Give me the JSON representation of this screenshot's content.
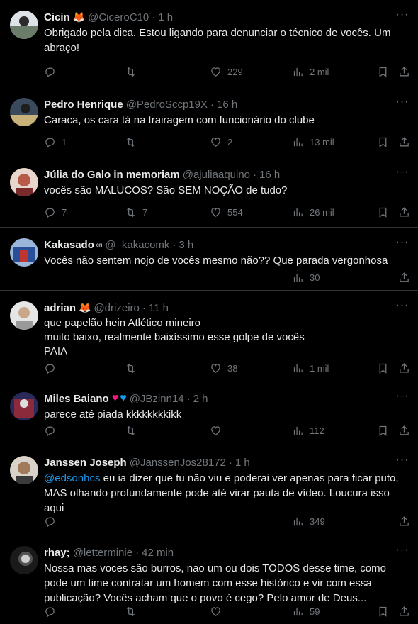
{
  "tweets": [
    {
      "name": "Cicin",
      "badge": "🦊",
      "handle": "@CiceroC10",
      "dot": "·",
      "time": "1 h",
      "text": [
        "Obrigado pela dica. Estou ligando para denunciar o técnico de vocês. Um",
        "abraço!"
      ],
      "replies": "",
      "retweets": "",
      "likes": "229",
      "views": "2 mil",
      "avatar_color": "#6b7d6a"
    },
    {
      "name": "Pedro Henrique",
      "handle": "@PedroSccp19X",
      "dot": "·",
      "time": "16 h",
      "text": [
        "Caraca, os cara tá na trairagem com funcionário do clube"
      ],
      "replies": "1",
      "retweets": "",
      "likes": "2",
      "views": "13 mil",
      "avatar_color": "#3a4a5c"
    },
    {
      "name": "Júlia do Galo in memoriam",
      "handle": "@ajuliaaquino",
      "dot": "·",
      "time": "16 h",
      "text": [
        "vocês são MALUCOS? São SEM NOÇÃO de tudo?"
      ],
      "replies": "7",
      "retweets": "7",
      "likes": "554",
      "views": "26 mil",
      "avatar_color": "#b85a4a"
    },
    {
      "name": "Kakasado",
      "badge_small": "cri",
      "handle": "@_kakacomk",
      "dot": "·",
      "time": "3 h",
      "text": [
        "Vocês não sentem nojo de vocês mesmo não?? Que parada vergonhosa"
      ],
      "replies": "",
      "retweets": "",
      "likes": "",
      "views": "30",
      "avatar_color": "#2a4f9a"
    },
    {
      "name": "adrian",
      "badge": "🦊",
      "handle": "@drizeiro",
      "dot": "·",
      "time": "11 h",
      "text": [
        "que papelão hein Atlético mineiro",
        "muito baixo, realmente baixíssimo esse golpe de vocês",
        "PAIA"
      ],
      "replies": "",
      "retweets": "",
      "likes": "38",
      "views": "1 mil",
      "avatar_color": "#c9c9c9"
    },
    {
      "name": "Miles Baiano",
      "heart1": "♥",
      "heart2": "♥",
      "handle": "@JBzinn14",
      "dot": "·",
      "time": "2 h",
      "text": [
        "parece até piada kkkkkkkkikk"
      ],
      "replies": "",
      "retweets": "",
      "likes": "",
      "views": "112",
      "avatar_color": "#8a2a3a"
    },
    {
      "name": "Janssen Joseph",
      "handle": "@JanssenJos28172",
      "dot": "·",
      "time": "1 h",
      "mention": "@edsonhcs",
      "text": [
        " eu ia dizer que tu não viu e poderai ver apenas para ficar puto,",
        "MAS olhando profundamente pode até virar pauta de vídeo. Loucura isso",
        "aqui"
      ],
      "replies": "",
      "retweets": "",
      "likes": "",
      "views": "349",
      "avatar_color": "#a07a5a"
    },
    {
      "name": "rhay;",
      "handle": "@letterminie",
      "dot": "·",
      "time": "42 min",
      "text": [
        "Nossa mas voces são burros, nao um ou dois TODOS desse time, como",
        "pode um time contratar um homem com esse histórico e vir com essa",
        "publicação? Vocês acham que o povo é cego? Pelo amor de Deus..."
      ],
      "replies": "",
      "retweets": "",
      "likes": "",
      "views": "59",
      "avatar_color": "#555"
    }
  ],
  "more_label": "···"
}
